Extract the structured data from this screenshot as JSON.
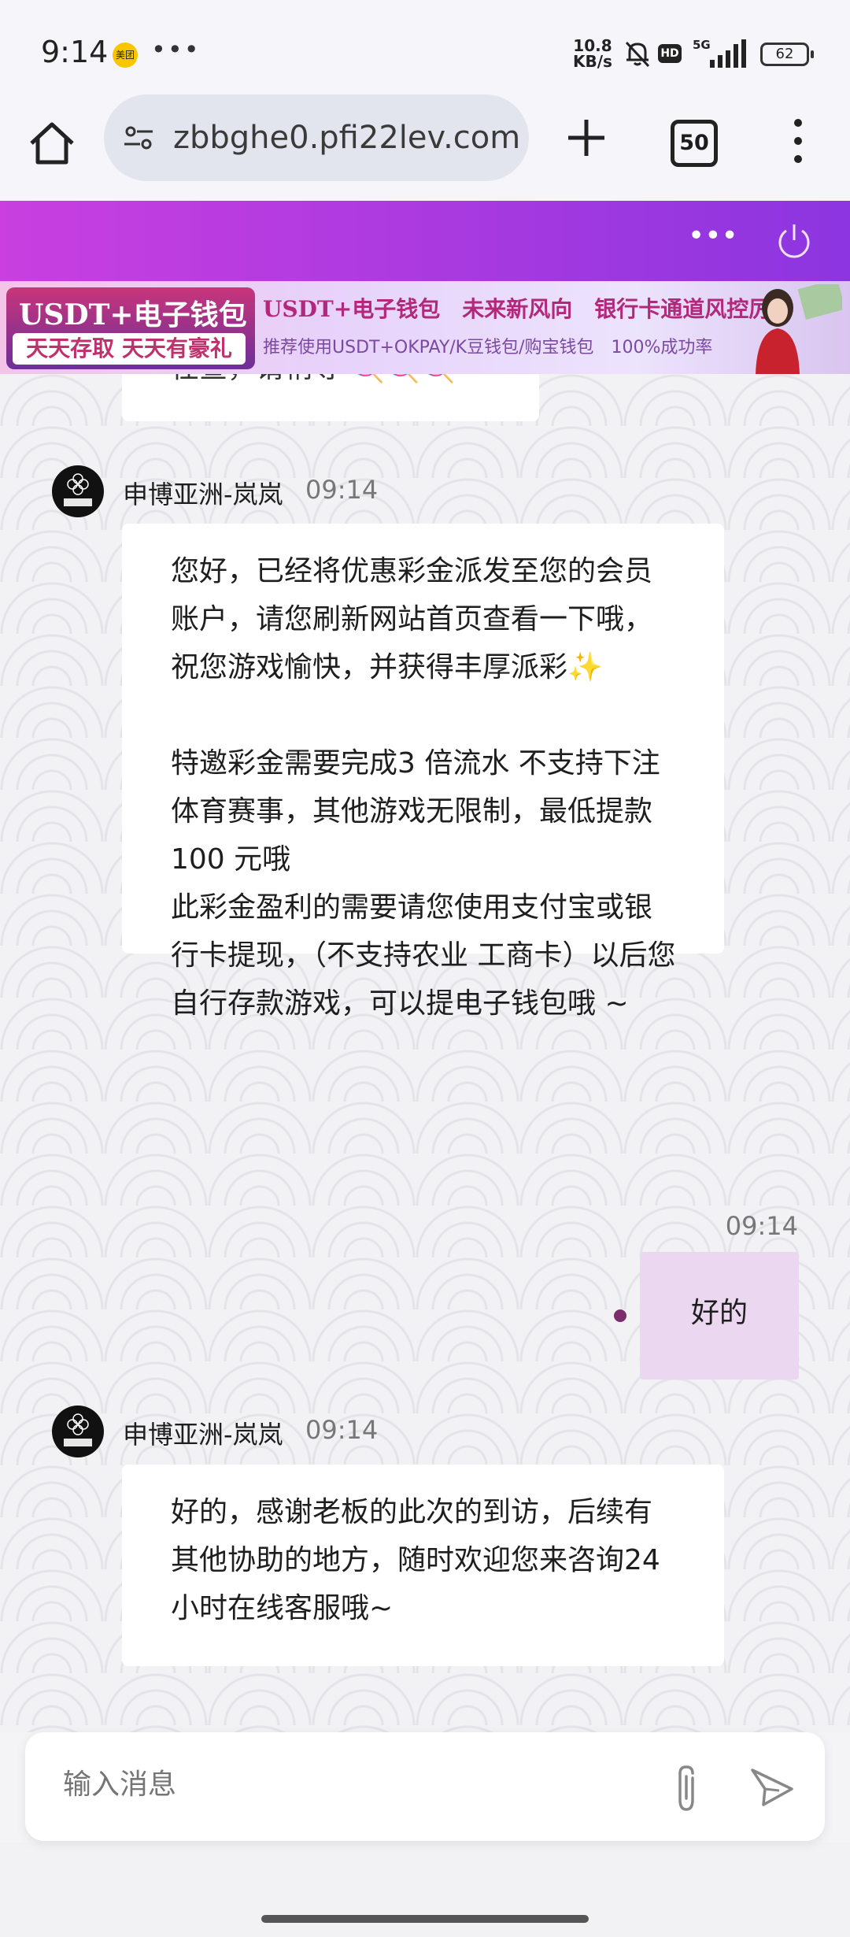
{
  "status_bar": {
    "time": "9:14",
    "notif_icon": "美团",
    "more": "•••",
    "net_speed_value": "10.8",
    "net_speed_unit": "KB/s",
    "hd_badge": "HD",
    "network": "5G",
    "battery": "62"
  },
  "browser": {
    "url": "zbbghe0.pfi22lev.com",
    "tab_count": "50"
  },
  "site_header": {
    "more_label": "•••"
  },
  "banner": {
    "left_title": "USDT+电子钱包",
    "left_sub": "天天存取 天天有豪礼",
    "headline": "USDT+电子钱包　未来新风向　银行卡通道风控厉害",
    "subline": "推荐使用USDT+OKPAY/K豆钱包/购宝钱包　100%成功率"
  },
  "chat": {
    "previous_fragment": "任查，请稍等 🍭🍭🍭",
    "messages": [
      {
        "sender": "申博亚洲-岚岚",
        "time": "09:14",
        "text": "您好，已经将优惠彩金派发至您的会员账户，请您刷新网站首页查看一下哦，祝您游戏愉快，并获得丰厚派彩✨\n\n特邀彩金需要完成3 倍流水 不支持下注体育赛事，其他游戏无限制，最低提款100 元哦\n此彩金盈利的需要请您使用支付宝或银行卡提现，（不支持农业 工商卡）以后您自行存款游戏，可以提电子钱包哦 ~"
      },
      {
        "mine": true,
        "time": "09:14",
        "text": "好的"
      },
      {
        "sender": "申博亚洲-岚岚",
        "time": "09:14",
        "text": "好的，感谢老板的此次的到访，后续有其他协助的地方，随时欢迎您来咨询24小时在线客服哦~"
      }
    ]
  },
  "composer": {
    "placeholder": "输入消息"
  },
  "colors": {
    "header_gradient_start": "#c93fe0",
    "header_gradient_end": "#8c35e0",
    "my_bubble": "#ebd7ef",
    "read_dot": "#7b2d6e"
  }
}
